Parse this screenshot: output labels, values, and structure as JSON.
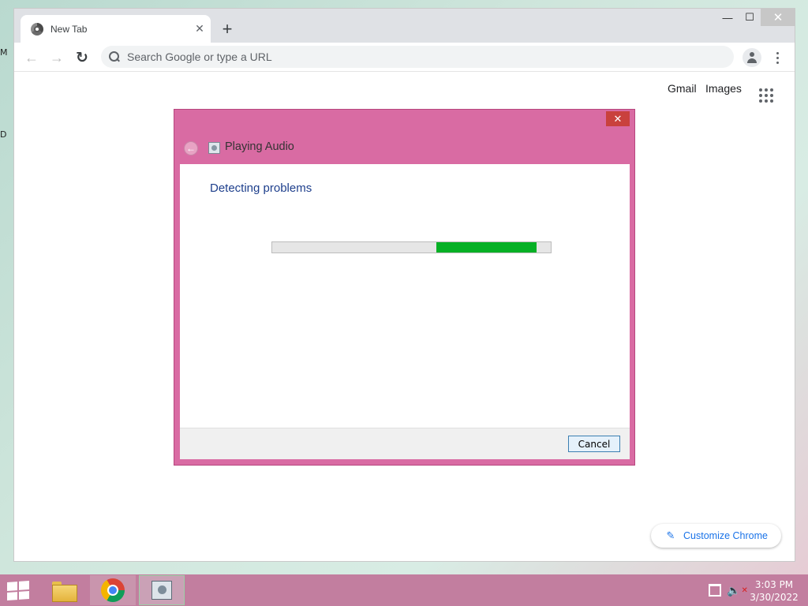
{
  "desktop": {
    "glyphs": [
      "M",
      "D"
    ]
  },
  "browser": {
    "tab": {
      "title": "New Tab",
      "close": "✕"
    },
    "new_tab": "+",
    "window_controls": {
      "minimize": "—",
      "maximize": "☐",
      "close": "✕"
    },
    "toolbar": {
      "back": "←",
      "forward": "→",
      "reload": "↻"
    },
    "omnibox": {
      "placeholder": "Search Google or type a URL"
    },
    "ntp": {
      "gmail": "Gmail",
      "images": "Images",
      "customize": "Customize Chrome",
      "pencil": "✎"
    }
  },
  "dialog": {
    "title": "Playing Audio",
    "close": "✕",
    "back": "←",
    "heading": "Detecting problems",
    "progress": {
      "start": 0.59,
      "end": 0.95
    },
    "cancel": "Cancel",
    "colors": {
      "frame": "#d96ba3",
      "progress": "#06b025",
      "heading": "#1e3f8c"
    }
  },
  "taskbar": {
    "apps": [
      "file-explorer",
      "google-chrome",
      "playing-audio-troubleshooter"
    ],
    "time": "3:03 PM",
    "date": "3/30/2022"
  }
}
